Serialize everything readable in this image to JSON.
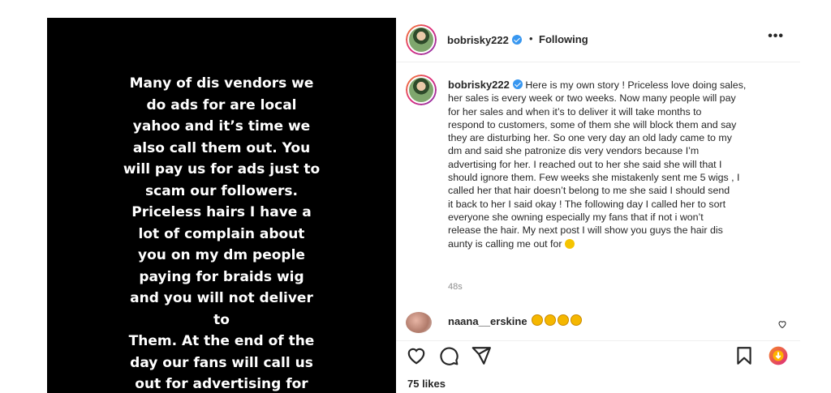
{
  "story": {
    "text": "Many of dis vendors we\ndo ads for are local\nyahoo and it’s time we\nalso call them out. You\nwill pay us for ads just to\nscam our followers.\nPriceless hairs I have a\nlot of complain about\nyou on my dm people\npaying for braids wig\nand you will not deliver\nto\nThem. At the end of the\nday our fans will call us\nout for advertising for"
  },
  "header": {
    "username": "bobrisky222",
    "separator": "•",
    "follow_status": "Following",
    "more_label": "•••"
  },
  "caption": {
    "username": "bobrisky222",
    "text": "Here is my own story ! Priceless love doing sales,\nher sales is every week or two weeks. Now many people will pay\nfor her sales and when it’s to deliver it will take months to\nrespond to customers, some of them she will block them and say\nthey are disturbing her. So one very day an old lady came to my\ndm and said she patronize dis very vendors because I’m\nadvertising for her. I reached out to her she said she will that I\nshould ignore them. Few weeks she mistakenly sent me 5 wigs , I\ncalled her that hair doesn’t belong to me she said I should send\nit back to her I said okay ! The following day I called her to sort\neveryone she owning especially my fans that if not i won’t\nrelease the hair. My next post I will show you guys the hair dis\naunty is calling me out for",
    "timestamp": "48s"
  },
  "comment": {
    "username": "naana__erskine"
  },
  "likes": {
    "count_text": "75 likes"
  },
  "icons": {
    "like": "heart-icon",
    "comment": "comment-icon",
    "share": "share-icon",
    "save": "bookmark-icon",
    "badge": "verified-icon"
  },
  "colors": {
    "verified": "#3897f0",
    "text": "#262626",
    "muted": "#8e8e8e"
  }
}
